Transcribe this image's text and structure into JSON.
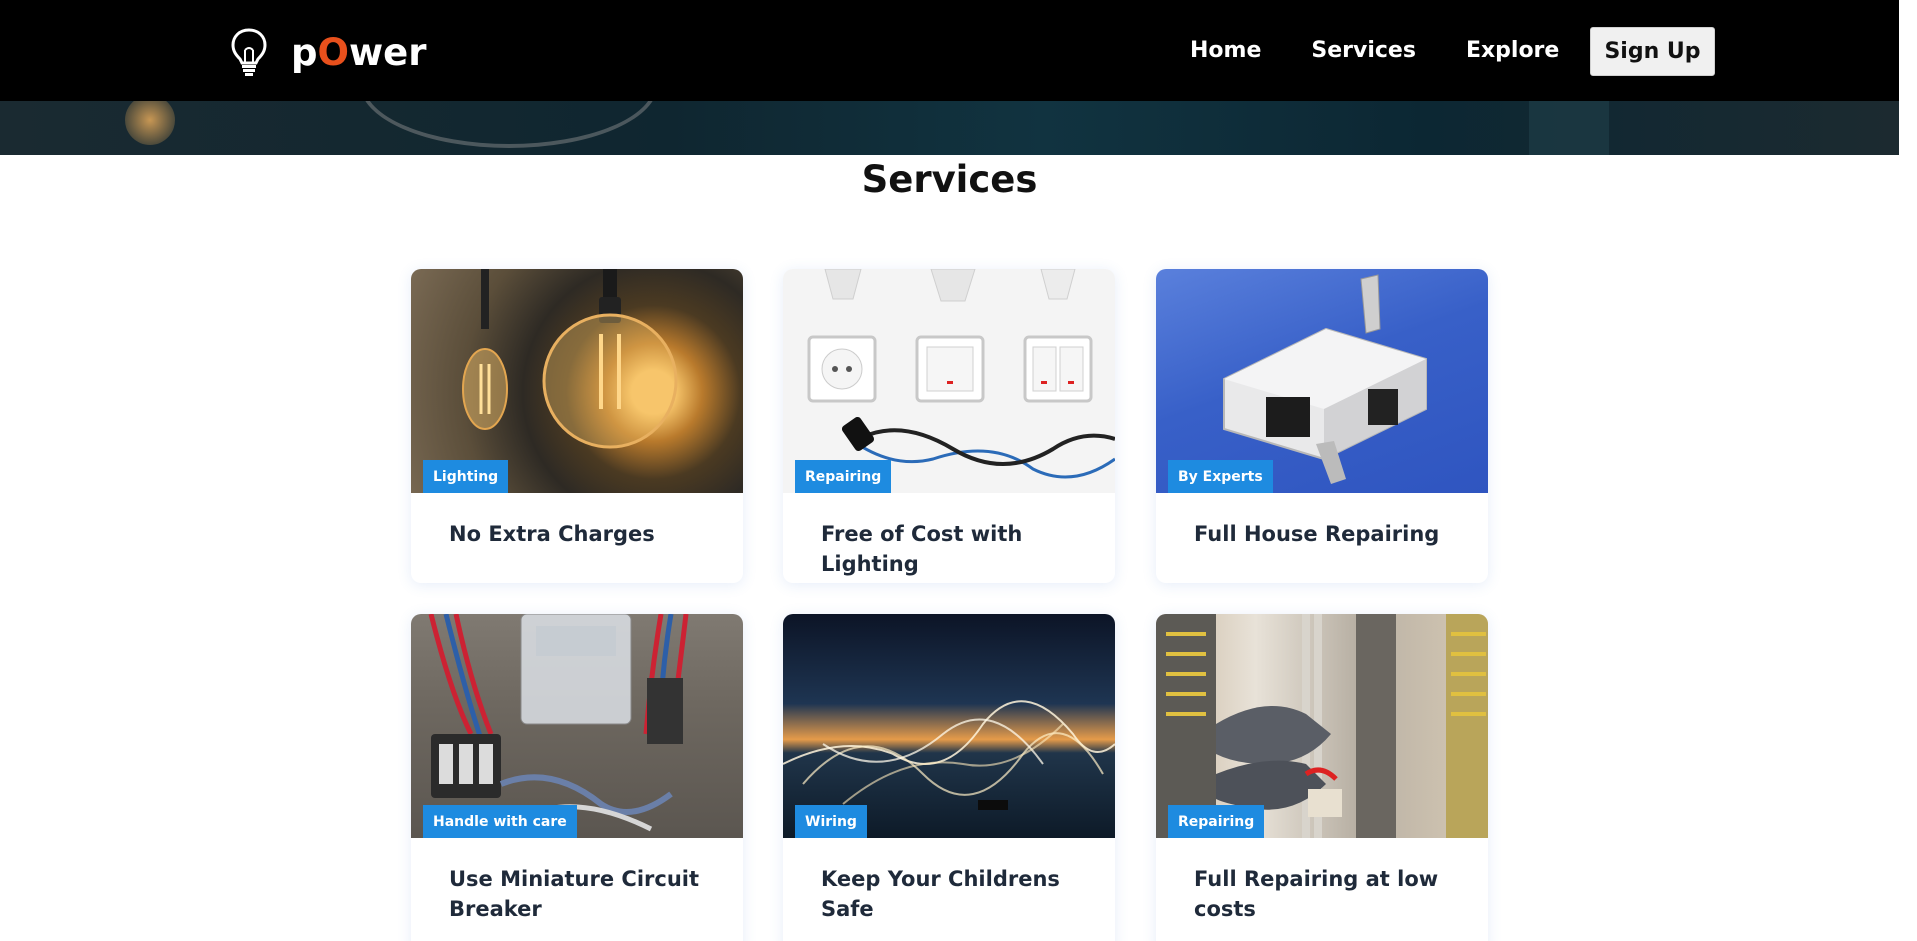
{
  "brand": {
    "name_prefix": "p",
    "name_accent": "O",
    "name_suffix": "wer",
    "accent_color": "#e8501c",
    "icon": "lightbulb-icon"
  },
  "nav": {
    "links": [
      {
        "label": "Home"
      },
      {
        "label": "Services"
      },
      {
        "label": "Explore"
      }
    ],
    "signup_label": "Sign Up"
  },
  "services": {
    "title": "Services",
    "badge_color": "#1e8be0",
    "cards": [
      {
        "badge": "Lighting",
        "title": "No Extra Charges",
        "image": "edison-bulbs-photo"
      },
      {
        "badge": "Repairing",
        "title": "Free of Cost with Lighting",
        "image": "bulbs-sockets-switches-photo"
      },
      {
        "badge": "By Experts",
        "title": "Full House Repairing",
        "image": "electronic-module-photo"
      },
      {
        "badge": "Handle with care",
        "title": "Use Miniature Circuit Breaker",
        "image": "circuit-breaker-box-photo"
      },
      {
        "badge": "Wiring",
        "title": "Keep Your Childrens Safe",
        "image": "light-trails-photo"
      },
      {
        "badge": "Repairing",
        "title": "Full Repairing at low costs",
        "image": "electrician-panel-photo"
      }
    ]
  }
}
